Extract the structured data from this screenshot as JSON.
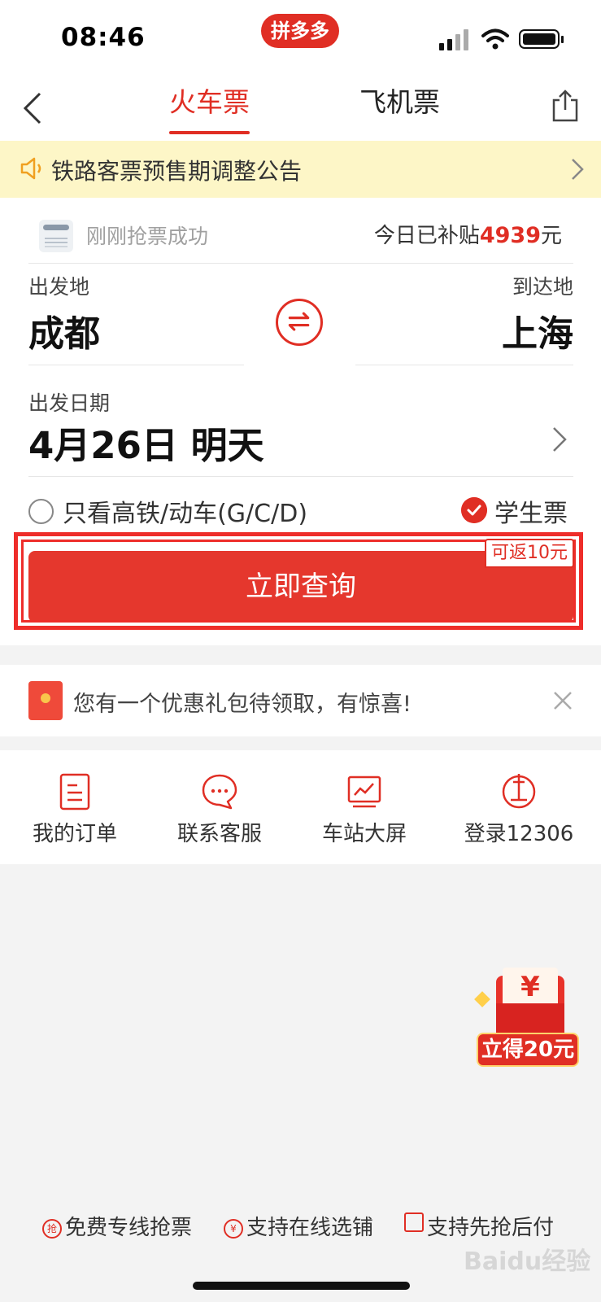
{
  "status_bar": {
    "time": "08:46",
    "app_pill": "拼多多"
  },
  "nav": {
    "tabs": [
      {
        "label": "火车票",
        "active": true
      },
      {
        "label": "飞机票",
        "active": false
      }
    ]
  },
  "notice": {
    "text": "铁路客票预售期调整公告"
  },
  "booking": {
    "grab_text": "刚刚抢票成功",
    "subsidy_prefix": "今日已补贴",
    "subsidy_amount": "4939",
    "subsidy_unit": "元",
    "from_label": "出发地",
    "from_city": "成都",
    "to_label": "到达地",
    "to_city": "上海",
    "date_label": "出发日期",
    "date_value": "4月26日 明天",
    "high_speed_label": "只看高铁/动车(G/C/D)",
    "high_speed_checked": false,
    "student_label": "学生票",
    "student_checked": true,
    "search_button": "立即查询",
    "rebate_tag": "可返10元"
  },
  "gift_banner": {
    "text": "您有一个优惠礼包待领取，有惊喜!"
  },
  "quick_links": [
    {
      "label": "我的订单",
      "icon": "order-icon"
    },
    {
      "label": "联系客服",
      "icon": "chat-icon"
    },
    {
      "label": "车站大屏",
      "icon": "screen-icon"
    },
    {
      "label": "登录12306",
      "icon": "railway-logo-icon"
    }
  ],
  "floating_red_packet": {
    "symbol": "¥",
    "label": "立得20元"
  },
  "features": [
    {
      "icon_text": "抢",
      "label": "免费专线抢票"
    },
    {
      "icon_text": "¥",
      "label": "支持在线选铺"
    },
    {
      "icon_text": "",
      "label": "支持先抢后付"
    }
  ],
  "watermark": "Baidu经验",
  "colors": {
    "accent": "#e02e24",
    "notice_bg": "#fdf6c7",
    "page_bg": "#f3f3f3",
    "highlight_box": "#ee2d2a"
  }
}
